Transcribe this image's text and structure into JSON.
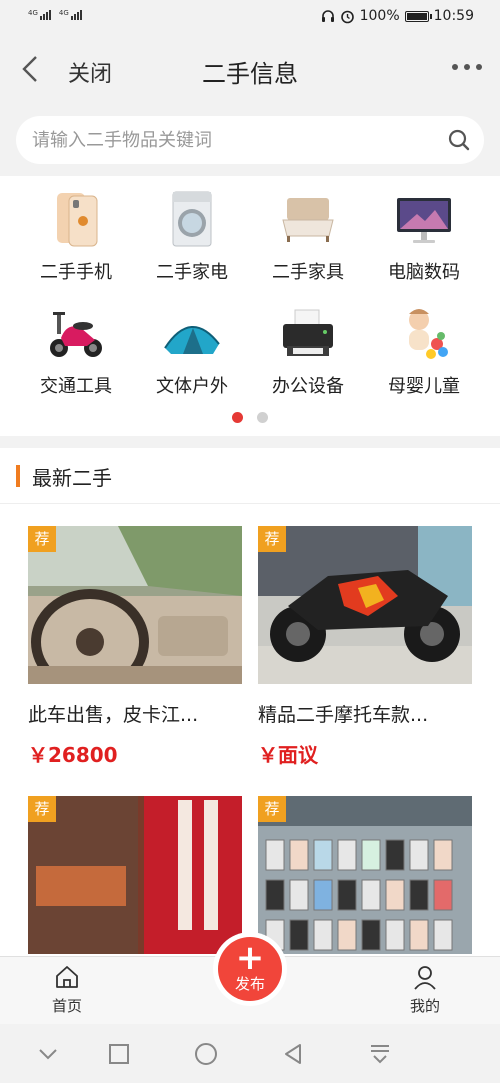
{
  "status_bar": {
    "net1": "4G",
    "net2": "4G",
    "battery": "100%",
    "time": "10:59"
  },
  "nav": {
    "close_label": "关闭",
    "title": "二手信息"
  },
  "search": {
    "placeholder": "请输入二手物品关键词"
  },
  "categories": [
    {
      "label": "二手手机",
      "icon": "phone-icon"
    },
    {
      "label": "二手家电",
      "icon": "washer-icon"
    },
    {
      "label": "二手家具",
      "icon": "bed-icon"
    },
    {
      "label": "电脑数码",
      "icon": "computer-icon"
    },
    {
      "label": "交通工具",
      "icon": "scooter-icon"
    },
    {
      "label": "文体户外",
      "icon": "tent-icon"
    },
    {
      "label": "办公设备",
      "icon": "printer-icon"
    },
    {
      "label": "母婴儿童",
      "icon": "baby-icon"
    }
  ],
  "carousel": {
    "pages": 2,
    "active": 1
  },
  "section": {
    "title": "最新二手"
  },
  "listings": [
    {
      "tag": "荐",
      "title": "此车出售，皮卡江...",
      "price": "￥26800"
    },
    {
      "tag": "荐",
      "title": "精品二手摩托车款...",
      "price": "￥面议"
    },
    {
      "tag": "荐",
      "title": "",
      "price": ""
    },
    {
      "tag": "荐",
      "title": "",
      "price": ""
    }
  ],
  "tabbar": {
    "home": "首页",
    "publish": "发布",
    "mine": "我的"
  },
  "colors": {
    "accent": "#f1453a",
    "price": "#e02020",
    "tag": "#f0a020",
    "section_bar": "#f07c20"
  }
}
